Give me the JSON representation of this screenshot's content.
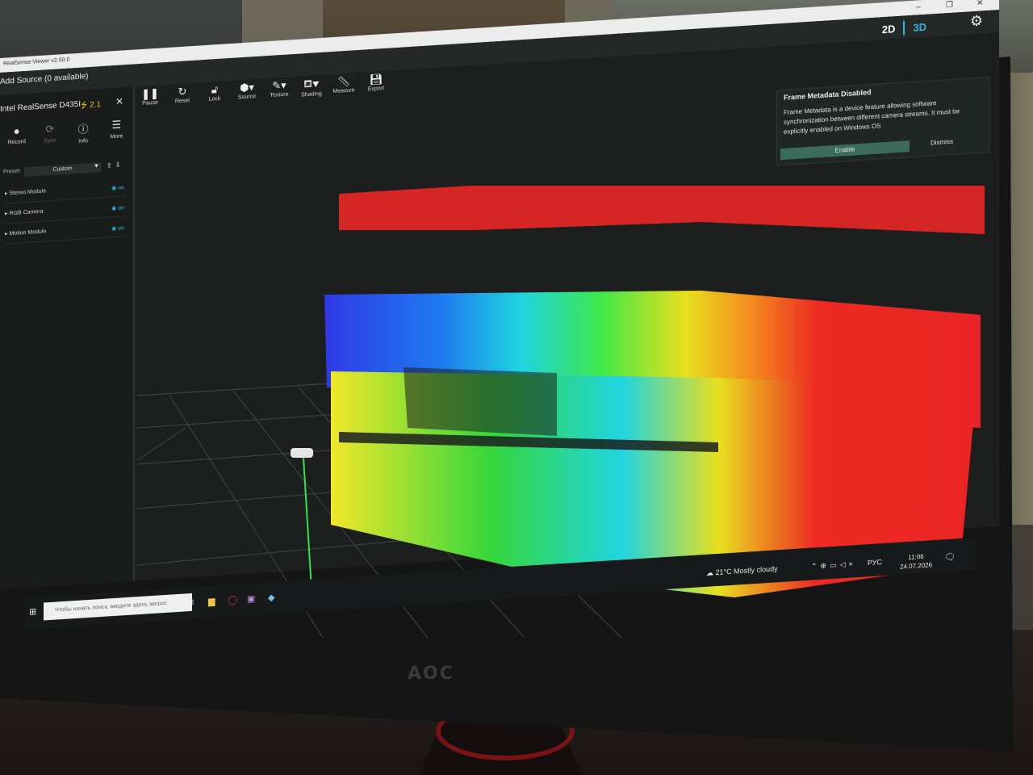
{
  "window": {
    "title": "RealSense Viewer v2.50.0",
    "minimize_icon": "minimize-icon",
    "maximize_icon": "maximize-icon",
    "close_icon": "close-icon"
  },
  "topbar": {
    "add_source": "Add Source (0 available)",
    "view_2d": "2D",
    "view_3d": "3D",
    "settings_icon": "gear-icon"
  },
  "device": {
    "name": "Intel RealSense D435I",
    "usb_label": "2.1",
    "buttons": [
      {
        "label": "Record",
        "icon": "record-icon"
      },
      {
        "label": "Sync",
        "icon": "sync-icon"
      },
      {
        "label": "Info",
        "icon": "info-icon"
      },
      {
        "label": "More",
        "icon": "menu-icon"
      }
    ],
    "preset_label": "Preset:",
    "preset_value": "Custom",
    "modules": [
      {
        "label": "Stereo Module",
        "state": "on"
      },
      {
        "label": "RGB Camera",
        "state": "on"
      },
      {
        "label": "Motion Module",
        "state": "on"
      }
    ]
  },
  "toolbar": {
    "buttons": [
      {
        "label": "Pause",
        "icon": "pause-icon"
      },
      {
        "label": "Reset",
        "icon": "reset-icon"
      },
      {
        "label": "Lock",
        "icon": "lock-icon"
      },
      {
        "label": "Source",
        "icon": "source-icon"
      },
      {
        "label": "Texture",
        "icon": "texture-icon"
      },
      {
        "label": "Shading",
        "icon": "shading-icon"
      },
      {
        "label": "Measure",
        "icon": "measure-icon"
      },
      {
        "label": "Export",
        "icon": "export-icon"
      }
    ]
  },
  "notification": {
    "title": "Frame Metadata Disabled",
    "body": "Frame Metadata is a device feature allowing software synchronization between different camera streams. It must be explicitly enabled on Windows OS",
    "enable": "Enable",
    "dismiss": "Dismiss"
  },
  "taskbar": {
    "search_placeholder": "Чтобы начать поиск, введите здесь запрос",
    "weather": "21°C  Mostly cloudy",
    "language": "РУС",
    "time": "11:06",
    "date": "24.07.2026"
  },
  "monitor_brand": "AOC",
  "colors": {
    "accent": "#33b7e5",
    "usb": "#f0c000",
    "enable_button": "#3b6c5a"
  }
}
